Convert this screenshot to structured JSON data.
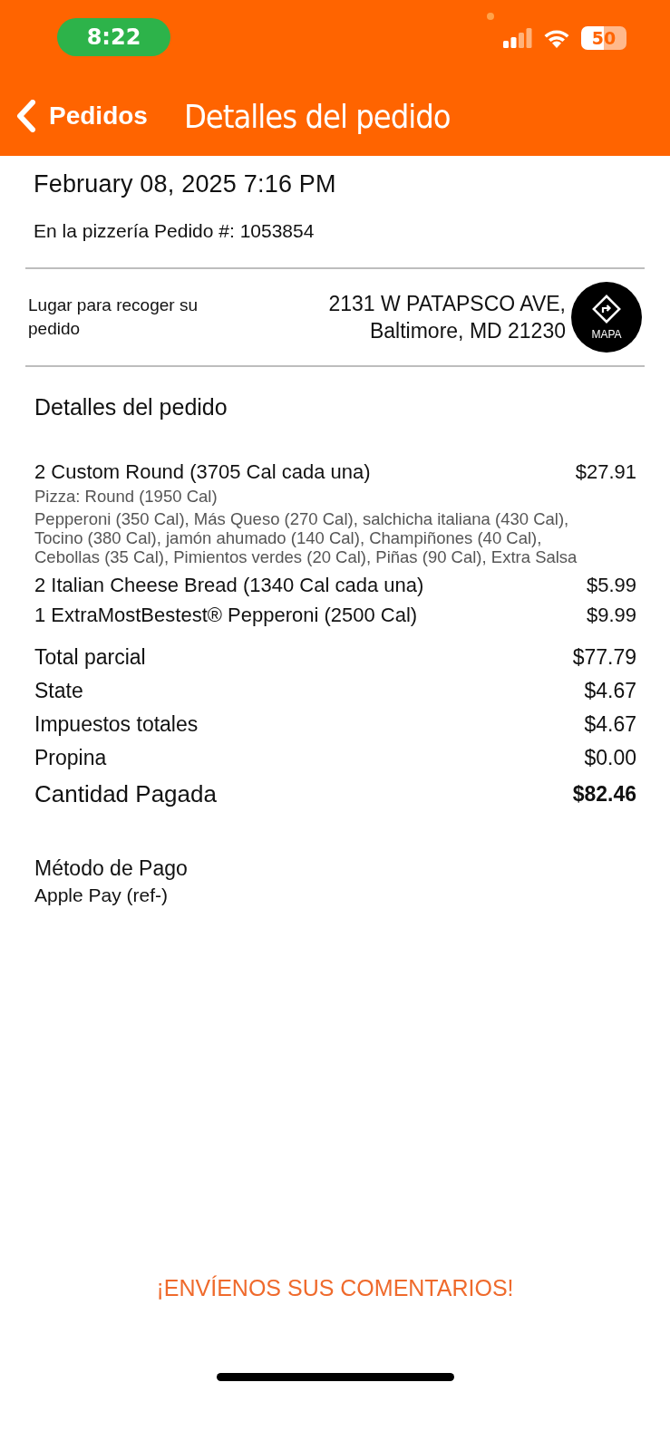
{
  "status_bar": {
    "time": "8:22",
    "battery": "50"
  },
  "header": {
    "back_label": "Pedidos",
    "title": "Detalles del pedido"
  },
  "order": {
    "date": "February 08, 2025 7:16 PM",
    "order_line": "En la pizzería Pedido #: 1053854"
  },
  "pickup": {
    "label": "Lugar para recoger su pedido",
    "address_lines": [
      "2131 W PATAPSCO AVE,",
      "Baltimore, MD 21230"
    ],
    "map_label": "MAPA"
  },
  "details": {
    "heading": "Detalles del pedido",
    "items": [
      {
        "name": "2 Custom Round (3705 Cal cada una)",
        "price": "$27.91",
        "description": [
          "Pizza: Round (1950 Cal)",
          "Pepperoni (350 Cal), Más Queso (270 Cal), salchicha italiana (430 Cal), Tocino (380 Cal), jamón ahumado (140 Cal), Champiñones (40 Cal), Cebollas (35 Cal), Pimientos verdes (20 Cal), Piñas (90 Cal), Extra Salsa"
        ]
      },
      {
        "name": "2 Italian Cheese Bread (1340 Cal cada una)",
        "price": "$5.99"
      },
      {
        "name": "1 ExtraMostBestest® Pepperoni (2500 Cal)",
        "price": "$9.99"
      }
    ]
  },
  "totals": [
    {
      "kind": "line",
      "label": "Total parcial",
      "amount": "$77.79"
    },
    {
      "kind": "line",
      "label": "State",
      "amount": "$4.67"
    },
    {
      "kind": "line",
      "label": "Impuestos totales",
      "amount": "$4.67"
    },
    {
      "kind": "line",
      "label": "Propina",
      "amount": "$0.00"
    },
    {
      "kind": "grand",
      "label": "Cantidad Pagada",
      "amount": "$82.46"
    }
  ],
  "payment": {
    "heading": "Método de Pago",
    "method": "Apple Pay (ref-)"
  },
  "feedback_link": "¡ENVÍENOS SUS COMENTARIOS!"
}
